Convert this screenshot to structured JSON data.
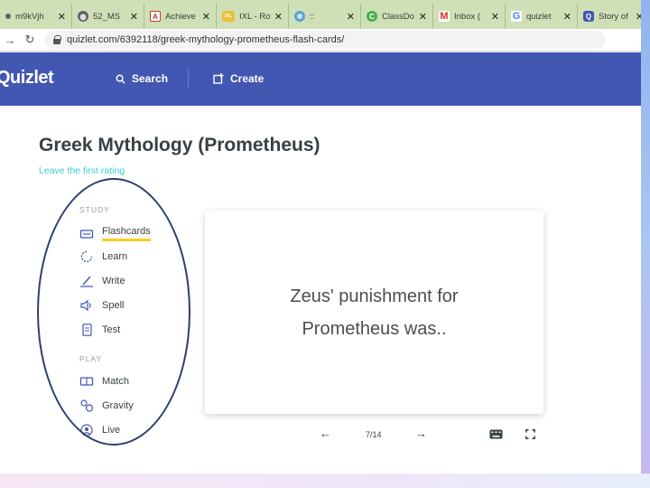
{
  "browser": {
    "tabs": [
      {
        "label": "m9kVjh",
        "favicon": "dot",
        "color": "#5f6368"
      },
      {
        "label": "52_MS",
        "favicon": "globe-icon",
        "color": "#5f6368"
      },
      {
        "label": "Achieve",
        "favicon": "A",
        "color": "#c0392b"
      },
      {
        "label": "IXL - Ro",
        "favicon": "IXL",
        "color": "#8ab92d"
      },
      {
        "label": "::",
        "favicon": "gear-icon",
        "color": "#5aa3d8"
      },
      {
        "label": "ClassDo",
        "favicon": "C",
        "color": "#4cae4f"
      },
      {
        "label": "Inbox (",
        "favicon": "M",
        "color": "#d93025"
      },
      {
        "label": "quizlet",
        "favicon": "G",
        "color": "#4285f4"
      },
      {
        "label": "Story of",
        "favicon": "Q",
        "color": "#4257b2"
      }
    ],
    "active_tab_favicon": "Q",
    "close_glyph": "✕",
    "url": "quizlet.com/6392118/greek-mythology-prometheus-flash-cards/"
  },
  "header": {
    "logo": "Quizlet",
    "search_label": "Search",
    "create_label": "Create"
  },
  "set": {
    "title": "Greek Mythology (Prometheus)",
    "rating_link": "Leave the first rating"
  },
  "sidebar": {
    "study_label": "STUDY",
    "study_modes": [
      "Flashcards",
      "Learn",
      "Write",
      "Spell",
      "Test"
    ],
    "play_label": "PLAY",
    "play_modes": [
      "Match",
      "Gravity",
      "Live"
    ],
    "active_mode": "Flashcards"
  },
  "card": {
    "text": "Zeus' punishment for Prometheus was.."
  },
  "controls": {
    "counter": "7/14",
    "prev_glyph": "←",
    "next_glyph": "→"
  },
  "colors": {
    "header_bg": "#4257b2",
    "rating_link": "#3ccfcf",
    "active_underline": "#ffcd1f",
    "tab_strip": "#cfe0b6",
    "oval_annotation": "#2d3f6e"
  }
}
